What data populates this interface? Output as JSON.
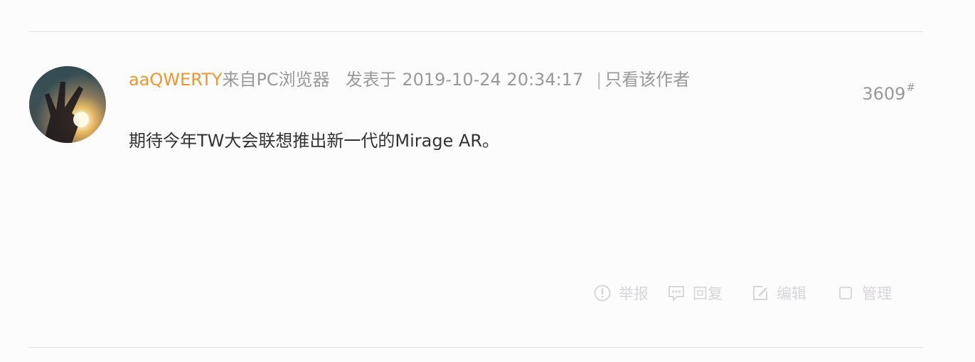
{
  "post": {
    "author": "aaQWERTY",
    "source": "来自PC浏览器",
    "date": "发表于 2019-10-24 20:34:17",
    "separator": "|",
    "only_author": "只看该作者",
    "floor_number": "3609",
    "floor_mark": "#",
    "content": "期待今年TW大会联想推出新一代的Mirage AR。"
  },
  "actions": {
    "report": "举报",
    "reply": "回复",
    "edit": "编辑",
    "manage": "管理"
  },
  "colors": {
    "author": "#f0962c",
    "meta": "#999999",
    "content": "#333333",
    "actions": "#d7d5d8",
    "divider": "#e2e2e2"
  }
}
